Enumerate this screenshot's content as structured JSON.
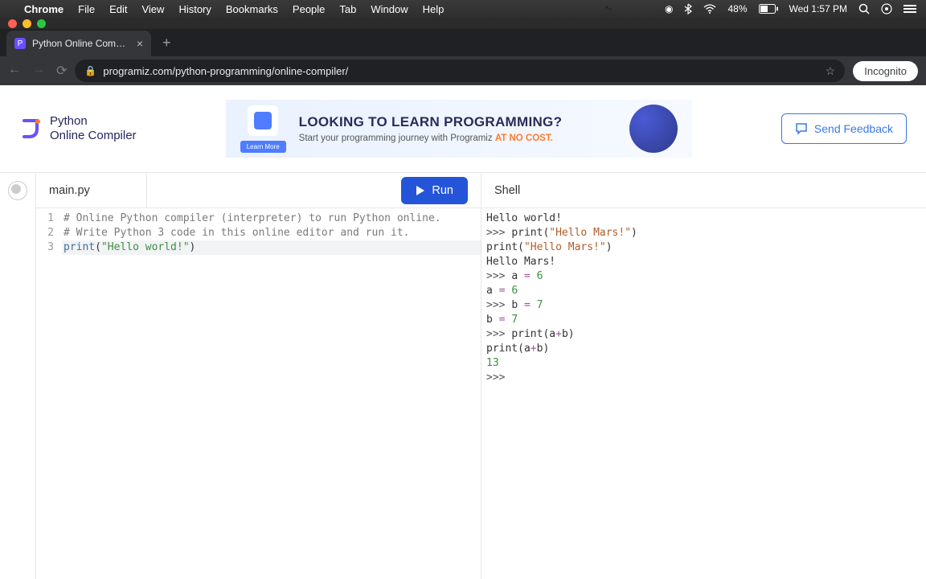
{
  "menubar": {
    "apple": "",
    "app": "Chrome",
    "items": [
      "File",
      "Edit",
      "View",
      "History",
      "Bookmarks",
      "People",
      "Tab",
      "Window",
      "Help"
    ],
    "battery": "48%",
    "datetime": "Wed 1:57 PM"
  },
  "browser": {
    "tab_title": "Python Online Compiler (Interp",
    "url": "programiz.com/python-programming/online-compiler/",
    "mode": "Incognito"
  },
  "page": {
    "logo_line1": "Python",
    "logo_line2": "Online Compiler",
    "banner": {
      "learn_more": "Learn More",
      "heading": "LOOKING TO LEARN PROGRAMMING?",
      "sub_pre": "Start your programming journey with Programiz ",
      "sub_accent": "AT NO COST."
    },
    "feedback": "Send Feedback"
  },
  "ide": {
    "file_tab": "main.py",
    "run": "Run",
    "shell_title": "Shell",
    "code": {
      "line1": "# Online Python compiler (interpreter) to run Python online.",
      "line2": "# Write Python 3 code in this online editor and run it.",
      "line3_func": "print",
      "line3_str": "\"Hello world!\""
    },
    "gutter": [
      "1",
      "2",
      "3"
    ],
    "shell": {
      "l1": "Hello world!",
      "l2_prompt": ">>> ",
      "l2_func": "print",
      "l2_str": "\"Hello Mars!\"",
      "l3_func": "print",
      "l3_str": "\"Hello Mars!\"",
      "l4": "Hello Mars!",
      "l5_prompt": ">>> ",
      "l5_expr": "a = 6",
      "l6_expr": "a = 6",
      "l7_prompt": ">>> ",
      "l7_expr": "b = 7",
      "l8_expr": "b = 7",
      "l9_prompt": ">>> ",
      "l9_func": "print",
      "l9_arg": "a+b",
      "l10_func": "print",
      "l10_arg": "a+b",
      "l11": "13",
      "l12_prompt": ">>> "
    }
  }
}
